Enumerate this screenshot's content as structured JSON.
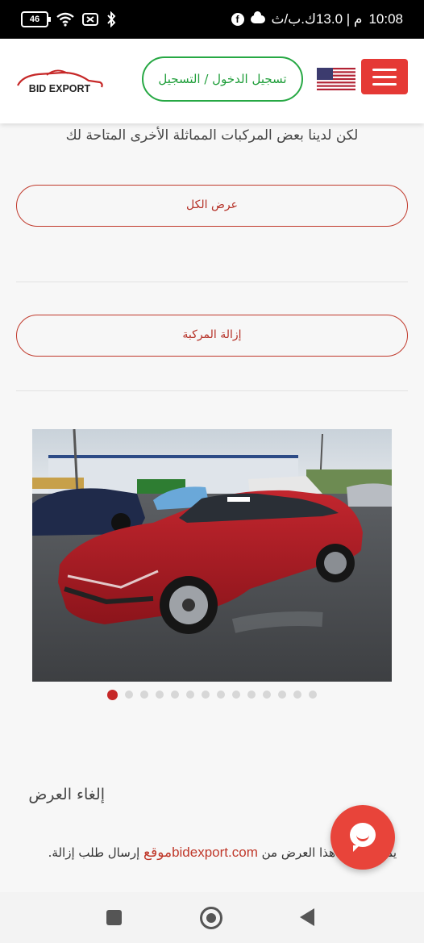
{
  "status_bar": {
    "time": "10:08",
    "right_info": "م | 13.0ك.ب/ث",
    "battery": "46",
    "icons": [
      "battery-icon",
      "wifi-icon",
      "no-sim-icon",
      "bluetooth-icon",
      "facebook-icon",
      "cloud-icon"
    ]
  },
  "header": {
    "logo_text": "BID EXPORT",
    "login_label": "تسجيل الدخول / التسجيل",
    "flag": "us-flag-icon",
    "menu_icon": "hamburger-menu-icon"
  },
  "main": {
    "similar_notice": "لكن لدينا بعض المركبات المماثلة الأخرى المتاحة لك",
    "view_all_label": "عرض الكل",
    "remove_vehicle_label": "إزالة المركبة",
    "gallery": {
      "image": "red-sedan-photo",
      "total_dots": 14,
      "active_index": 0
    },
    "cancel_section": {
      "title": "إلغاء العرض",
      "text_before": "يمكنك إزالة هذا العرض من",
      "site": "bidexport.com",
      "text_after": "موقع",
      "text_end": "إرسال طلب إزالة."
    }
  },
  "chat": {
    "icon": "chat-icon"
  },
  "nav_bar": {
    "icons": [
      "recent-apps-icon",
      "home-icon",
      "back-icon"
    ]
  },
  "colors": {
    "accent_red": "#e53935",
    "login_green": "#27a844",
    "link_red": "#c0392b"
  }
}
